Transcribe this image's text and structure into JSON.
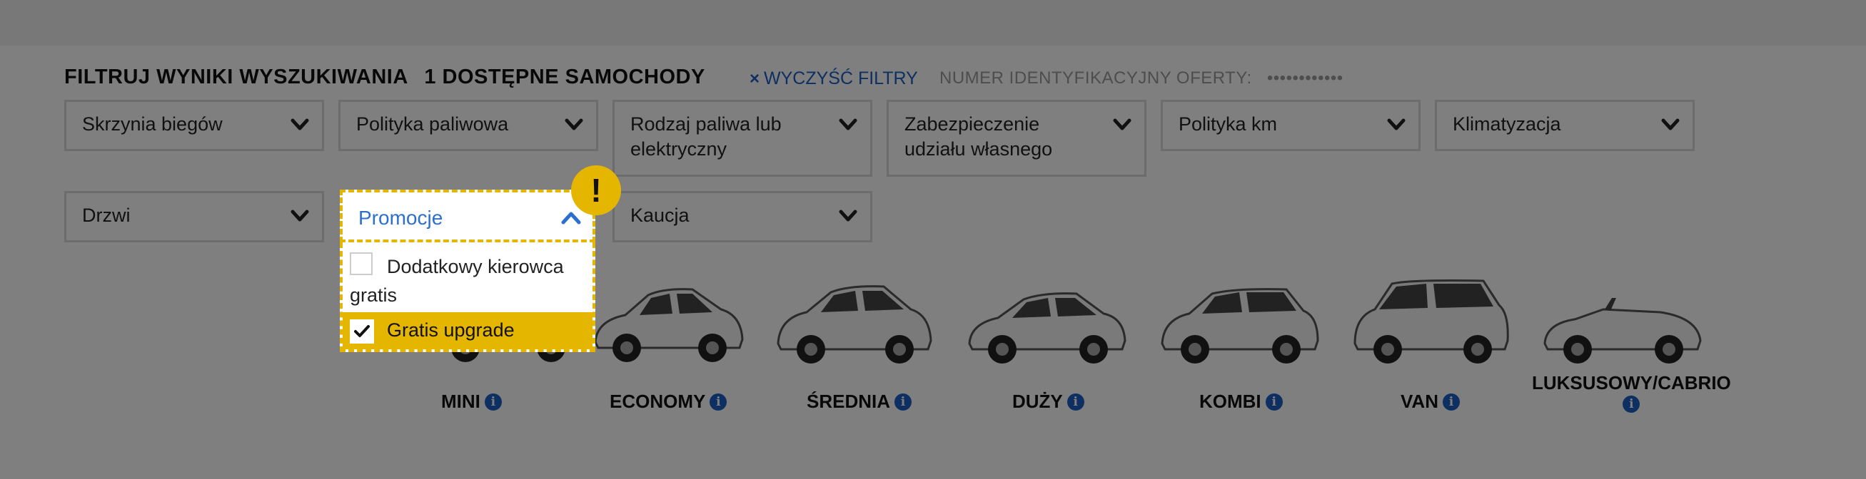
{
  "header": {
    "filter_title": "FILTRUJ WYNIKI WYSZUKIWANIA",
    "available": "1 DOSTĘPNE SAMOCHODY",
    "clear_icon": "×",
    "clear_label": "WYCZYŚĆ FILTRY",
    "offer_label": "NUMER IDENTYFIKACYJNY OFERTY:",
    "offer_value": "••••••••••••"
  },
  "filters": [
    {
      "label": "Skrzynia biegów"
    },
    {
      "label": "Polityka paliwowa"
    },
    {
      "label": "Rodzaj paliwa lub elektryczny"
    },
    {
      "label": "Zabezpieczenie udziału własnego"
    },
    {
      "label": "Polityka km"
    },
    {
      "label": "Klimatyzacja"
    },
    {
      "label": "Drzwi"
    },
    {
      "label": "Kaucja"
    }
  ],
  "promo": {
    "label": "Promocje",
    "options": [
      {
        "label": "Dodatkowy kierowca gratis",
        "checked": false
      },
      {
        "label": "Gratis upgrade",
        "checked": true
      }
    ],
    "badge": "!"
  },
  "categories": [
    {
      "label": "MINI",
      "icon": "info-icon"
    },
    {
      "label": "ECONOMY",
      "icon": "info-icon"
    },
    {
      "label": "ŚREDNIA",
      "icon": "info-icon"
    },
    {
      "label": "DUŻY",
      "icon": "info-icon"
    },
    {
      "label": "KOMBI",
      "icon": "info-icon"
    },
    {
      "label": "VAN",
      "icon": "info-icon"
    },
    {
      "label": "LUKSUSOWY/CABRIO",
      "icon": "info-icon"
    }
  ],
  "info_glyph": "i",
  "colors": {
    "accent": "#e5b600",
    "link": "#1a5fc2",
    "overlay": "rgba(0,0,0,0.5)"
  }
}
